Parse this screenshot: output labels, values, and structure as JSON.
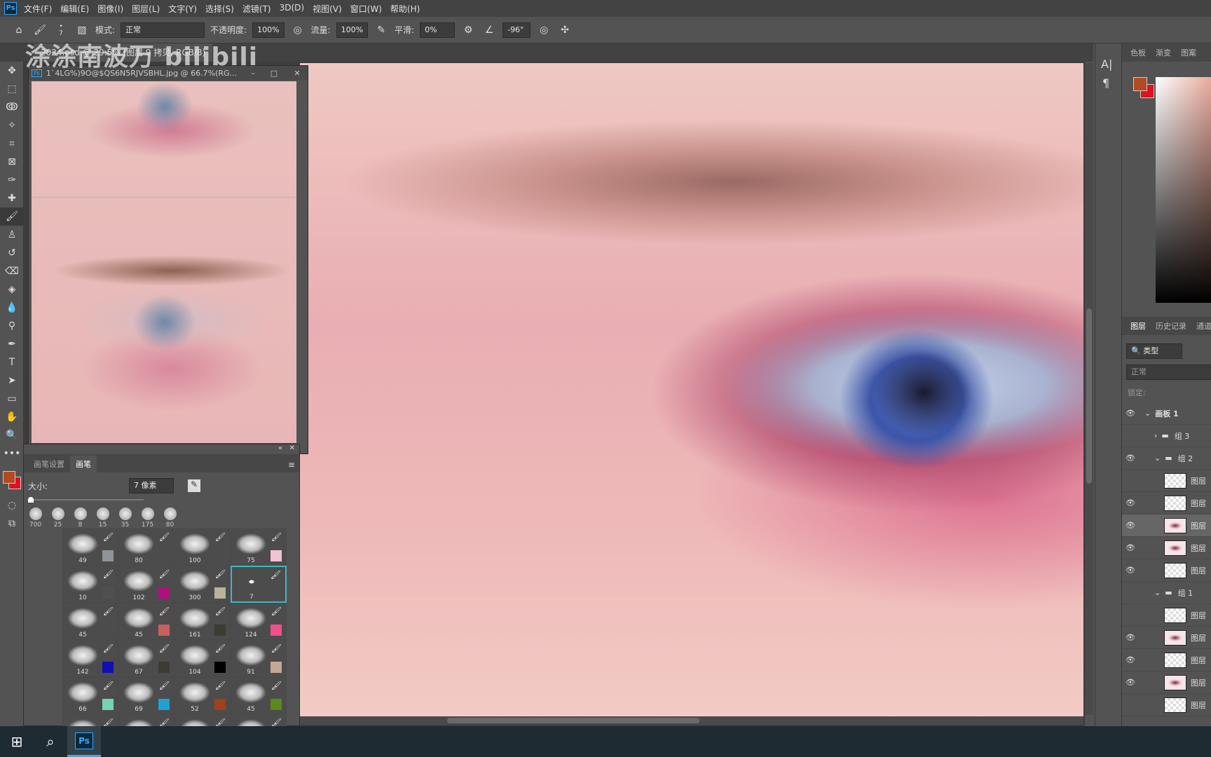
{
  "menu": [
    "文件(F)",
    "编辑(E)",
    "图像(I)",
    "图层(L)",
    "文字(Y)",
    "选择(S)",
    "滤镜(T)",
    "3D(D)",
    "视图(V)",
    "窗口(W)",
    "帮助(H)"
  ],
  "app_icon": "Ps",
  "options": {
    "brush_size": "7",
    "mode_label": "模式:",
    "mode_value": "正常",
    "opacity_label": "不透明度:",
    "opacity_value": "100%",
    "flow_label": "流量:",
    "flow_value": "100%",
    "smooth_label": "平滑:",
    "smooth_value": "0%",
    "angle_value": "-96°"
  },
  "watermark": "涂涂南波万 bilibili",
  "doc_tab": "2024.psd @ 29.5% (图层 9 拷贝, RGB/8)",
  "ref_window": {
    "title": "1`4LG%)9O@$QS6N5RJVSBHL.jpg @ 66.7%(RG..."
  },
  "brush_panel": {
    "tabs": [
      "画笔设置",
      "画笔"
    ],
    "active_tab": 1,
    "size_label": "大小:",
    "size_value": "7 像素",
    "presets": [
      "700",
      "25",
      "8",
      "15",
      "35",
      "175",
      "80"
    ],
    "brushes": [
      {
        "size": "49",
        "color": "#8e949a"
      },
      {
        "size": "80",
        "color": ""
      },
      {
        "size": "100",
        "color": ""
      },
      {
        "size": "75",
        "color": "#f0c4d0"
      },
      {
        "size": "10",
        "color": "#505050"
      },
      {
        "size": "102",
        "color": "#b0107c"
      },
      {
        "size": "300",
        "color": "#b9b29c"
      },
      {
        "size": "7",
        "color": "",
        "selected": true
      },
      {
        "size": "45",
        "color": ""
      },
      {
        "size": "45",
        "color": "#c8605c"
      },
      {
        "size": "161",
        "color": "#3c3c30"
      },
      {
        "size": "124",
        "color": "#f0508a"
      },
      {
        "size": "142",
        "color": "#1010b0"
      },
      {
        "size": "67",
        "color": "#3e3a36"
      },
      {
        "size": "104",
        "color": "#000000"
      },
      {
        "size": "91",
        "color": "#c4a894"
      },
      {
        "size": "66",
        "color": "#74d4b4"
      },
      {
        "size": "69",
        "color": "#22a0d0"
      },
      {
        "size": "52",
        "color": "#a0401c"
      },
      {
        "size": "45",
        "color": "#5a8a18"
      },
      {
        "size": "",
        "color": "#bcd4ec"
      },
      {
        "size": "",
        "color": "#000000"
      },
      {
        "size": "",
        "color": "#000000"
      },
      {
        "size": "",
        "color": "#000000"
      }
    ]
  },
  "colors": {
    "foreground": "#b34a22",
    "background": "#e0101e",
    "selection": "#3fb6c8"
  },
  "right_panel": {
    "color_tabs": [
      "色板",
      "渐变",
      "图案"
    ],
    "layer_tabs": [
      "图层",
      "历史记录",
      "通道"
    ],
    "filter_label": "类型",
    "blend_mode": "正常",
    "lock_label": "锁定:",
    "layers": [
      {
        "name": "画板 1",
        "visible": true,
        "kind": "artboard"
      },
      {
        "name": "组 3",
        "visible": false,
        "kind": "group",
        "indent": 1
      },
      {
        "name": "组 2",
        "visible": true,
        "kind": "group",
        "indent": 1
      },
      {
        "name": "图层",
        "visible": false,
        "kind": "layer",
        "thumb": "empty"
      },
      {
        "name": "图层",
        "visible": true,
        "kind": "layer",
        "thumb": "empty"
      },
      {
        "name": "图层",
        "visible": true,
        "kind": "layer",
        "thumb": "eye",
        "selected": true
      },
      {
        "name": "图层",
        "visible": true,
        "kind": "layer",
        "thumb": "eye"
      },
      {
        "name": "图层",
        "visible": true,
        "kind": "layer",
        "thumb": "empty"
      },
      {
        "name": "组 1",
        "visible": false,
        "kind": "group",
        "indent": 1
      },
      {
        "name": "图层",
        "visible": false,
        "kind": "layer",
        "thumb": "empty"
      },
      {
        "name": "图层",
        "visible": true,
        "kind": "layer",
        "thumb": "eye"
      },
      {
        "name": "图层",
        "visible": true,
        "kind": "layer",
        "thumb": "empty"
      },
      {
        "name": "图层",
        "visible": true,
        "kind": "layer",
        "thumb": "eye"
      },
      {
        "name": "图层",
        "visible": false,
        "kind": "layer",
        "thumb": "empty"
      }
    ]
  },
  "taskbar": {
    "ps_label": "Ps"
  }
}
